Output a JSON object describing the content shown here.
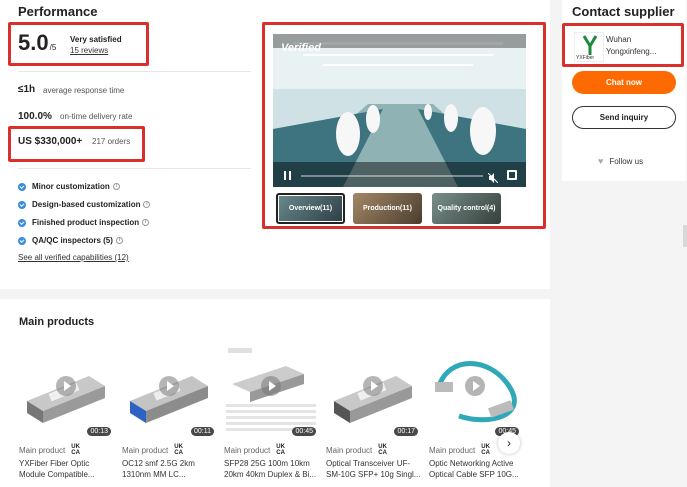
{
  "performance": {
    "title": "Performance",
    "rating": "5.0",
    "rating_scale": "/5",
    "satisfaction": "Very satisfied",
    "reviews": "15 reviews",
    "response_value": "≤1h",
    "response_label": "average response time",
    "delivery_value": "100.0%",
    "delivery_label": "on-time delivery rate",
    "revenue": "US $330,000+",
    "orders": "217 orders",
    "capabilities": [
      "Minor customization",
      "Design-based customization",
      "Finished product inspection",
      "QA/QC inspectors (5)"
    ],
    "see_all": "See all verified capabilities (12)"
  },
  "video": {
    "verified_label": "Verified",
    "tabs": [
      "Overview(11)",
      "Production(11)",
      "Quality control(4)"
    ]
  },
  "supplier": {
    "title": "Contact supplier",
    "logo_text": "YXFiber",
    "name_line1": "Wuhan",
    "name_line2": "Yongxinfeng...",
    "chat_label": "Chat now",
    "inquiry_label": "Send inquiry",
    "follow_label": "Follow us",
    "accent": "#ff6a00"
  },
  "main_products": {
    "title": "Main products",
    "items": [
      {
        "label": "Main product",
        "badge_top": "UK",
        "badge_bottom": "CA",
        "name1": "YXFiber Fiber Optic",
        "name2": "Module Compatible...",
        "duration": "00:13"
      },
      {
        "label": "Main product",
        "badge_top": "UK",
        "badge_bottom": "CA",
        "name1": "OC12 smf 2.5G 2km",
        "name2": "1310nm MM LC...",
        "duration": "00:11"
      },
      {
        "label": "Main product",
        "badge_top": "UK",
        "badge_bottom": "CA",
        "name1": "SFP28 25G 100m 10km",
        "name2": "20km 40km Duplex & Bi...",
        "duration": "00:45"
      },
      {
        "label": "Main product",
        "badge_top": "UK",
        "badge_bottom": "CA",
        "name1": "Optical Transceiver UF-",
        "name2": "SM-10G SFP+ 10g Singl...",
        "duration": "00:17"
      },
      {
        "label": "Main product",
        "badge_top": "UK",
        "badge_bottom": "CA",
        "name1": "Optic Networking Active",
        "name2": "Optical Cable SFP 10G...",
        "duration": "00:45"
      }
    ]
  }
}
